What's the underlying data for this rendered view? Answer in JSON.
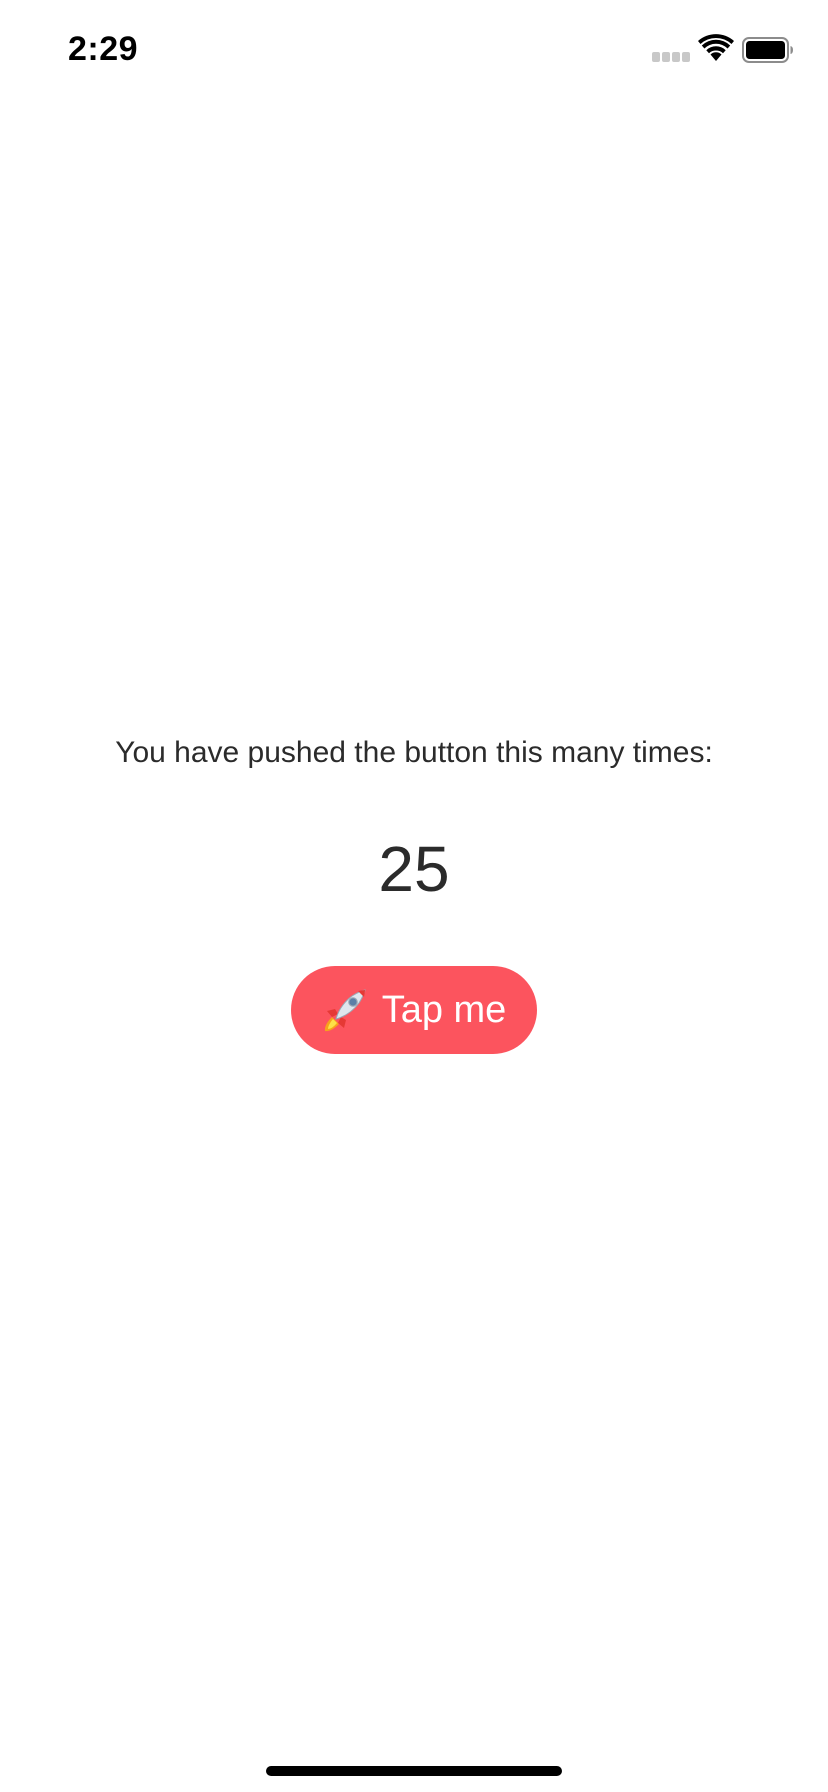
{
  "status_bar": {
    "time": "2:29",
    "icons": [
      "cellular-signal-icon",
      "wifi-icon",
      "battery-icon"
    ]
  },
  "main": {
    "message": "You have pushed the button this many times:",
    "counter": "25",
    "button": {
      "icon": "rocket-icon",
      "label": "Tap me"
    }
  },
  "colors": {
    "button_background": "#fc545e",
    "button_text": "#ffffff",
    "text": "#2b2b2b",
    "background": "#ffffff"
  }
}
